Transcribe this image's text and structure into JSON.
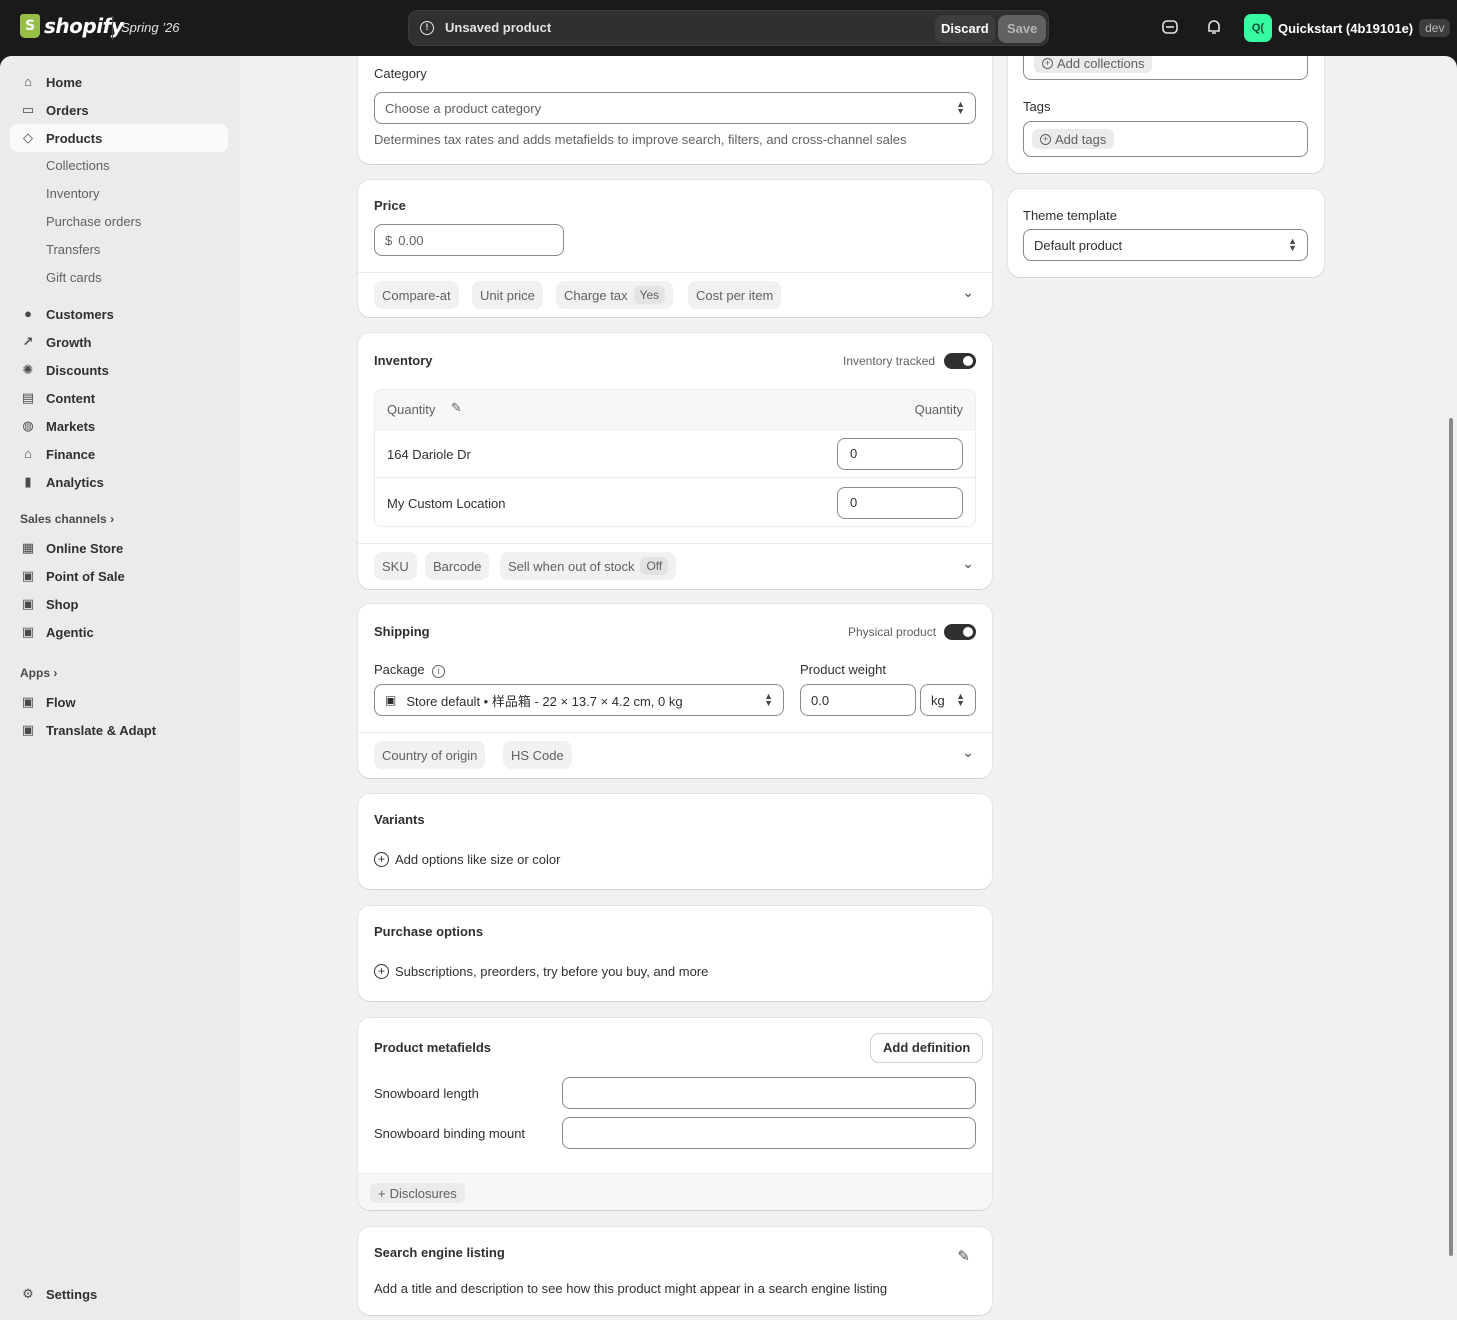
{
  "topbar": {
    "logo_text": "shopify",
    "edition": "Spring ’26",
    "unsaved_label": "Unsaved product",
    "discard_label": "Discard",
    "save_label": "Save",
    "store_avatar": "Q(",
    "store_name": "Quickstart (4b19101e)",
    "store_badge": "dev"
  },
  "sidebar": {
    "items": [
      {
        "label": "Home",
        "icon": "home-icon"
      },
      {
        "label": "Orders",
        "icon": "orders-icon"
      },
      {
        "label": "Products",
        "icon": "tag-icon",
        "active": true
      }
    ],
    "product_subitems": [
      "Collections",
      "Inventory",
      "Purchase orders",
      "Transfers",
      "Gift cards"
    ],
    "items2": [
      {
        "label": "Customers",
        "icon": "person-icon"
      },
      {
        "label": "Growth",
        "icon": "growth-icon"
      },
      {
        "label": "Discounts",
        "icon": "discount-icon"
      },
      {
        "label": "Content",
        "icon": "content-icon"
      },
      {
        "label": "Markets",
        "icon": "globe-icon"
      },
      {
        "label": "Finance",
        "icon": "bank-icon"
      },
      {
        "label": "Analytics",
        "icon": "chart-icon"
      }
    ],
    "sales_channels_label": "Sales channels",
    "channels": [
      "Online Store",
      "Point of Sale",
      "Shop",
      "Agentic"
    ],
    "apps_label": "Apps",
    "apps": [
      "Flow",
      "Translate & Adapt"
    ],
    "settings_label": "Settings"
  },
  "category": {
    "label": "Category",
    "placeholder": "Choose a product category",
    "help": "Determines tax rates and adds metafields to improve search, filters, and cross-channel sales"
  },
  "price": {
    "title": "Price",
    "currency": "$",
    "placeholder": "0.00",
    "pills": {
      "compare_at": "Compare-at",
      "unit_price": "Unit price",
      "charge_tax": "Charge tax",
      "charge_tax_value": "Yes",
      "cost_per_item": "Cost per item"
    }
  },
  "inventory": {
    "title": "Inventory",
    "tracked_label": "Inventory tracked",
    "tracked": true,
    "col_left": "Quantity",
    "col_right": "Quantity",
    "rows": [
      {
        "location": "164 Dariole Dr",
        "qty": "0"
      },
      {
        "location": "My Custom Location",
        "qty": "0"
      }
    ],
    "pills": {
      "sku": "SKU",
      "barcode": "Barcode",
      "sell_oos": "Sell when out of stock",
      "sell_oos_value": "Off"
    }
  },
  "shipping": {
    "title": "Shipping",
    "physical_label": "Physical product",
    "physical": true,
    "package_label": "Package",
    "package_value": "Store default • 样品箱 - 22 × 13.7 × 4.2 cm, 0 kg",
    "weight_label": "Product weight",
    "weight_value": "0.0",
    "weight_unit": "kg",
    "pills": {
      "country": "Country of origin",
      "hs": "HS Code"
    }
  },
  "variants": {
    "title": "Variants",
    "add_label": "Add options like size or color"
  },
  "purchase_options": {
    "title": "Purchase options",
    "add_label": "Subscriptions, preorders, try before you buy, and more"
  },
  "metafields": {
    "title": "Product metafields",
    "add_definition": "Add definition",
    "fields": [
      "Snowboard length",
      "Snowboard binding mount"
    ],
    "disclosures": "Disclosures"
  },
  "seo": {
    "title": "Search engine listing",
    "help": "Add a title and description to see how this product might appear in a search engine listing"
  },
  "organization": {
    "add_collections": "Add collections",
    "tags_label": "Tags",
    "add_tags": "Add tags"
  },
  "theme": {
    "label": "Theme template",
    "value": "Default product"
  }
}
